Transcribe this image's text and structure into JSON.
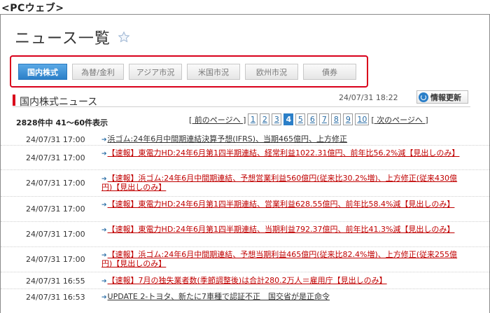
{
  "caption": "<PCウェブ>",
  "title": "ニュース一覧",
  "tabs": [
    {
      "label": "国内株式",
      "active": true
    },
    {
      "label": "為替/金利",
      "active": false
    },
    {
      "label": "アジア市況",
      "active": false
    },
    {
      "label": "米国市況",
      "active": false
    },
    {
      "label": "欧州市況",
      "active": false
    },
    {
      "label": "債券",
      "active": false
    }
  ],
  "section": {
    "title": "国内株式ニュース",
    "updated_at": "24/07/31 18:22",
    "refresh_label": "情報更新"
  },
  "count_text": "2828件中 41～60件表示",
  "pager": {
    "prev": "[ 前のページへ ]",
    "next": "[ 次のページへ ]",
    "pages": [
      "1",
      "2",
      "3",
      "4",
      "5",
      "6",
      "7",
      "8",
      "9",
      "10"
    ],
    "current": "4"
  },
  "news": [
    {
      "time": "24/07/31 17:00",
      "headline": "浜ゴム:24年6月中間期連結決算予想(IFRS)、当期465億円、上方修正",
      "highlight": false
    },
    {
      "time": "24/07/31 17:00",
      "headline": "【速報】東電力HD:24年6月第1四半期連結、経常利益1022.31億円、前年比56.2%減【見出しのみ】",
      "highlight": true
    },
    {
      "time": "24/07/31 17:00",
      "headline": "【速報】浜ゴム:24年6月中間期連結、予想営業利益560億円(従来比30.2%増)、上方修正(従来430億円)【見出しのみ】",
      "highlight": true
    },
    {
      "time": "24/07/31 17:00",
      "headline": "【速報】東電力HD:24年6月第1四半期連結、営業利益628.55億円、前年比58.4%減【見出しのみ】",
      "highlight": true
    },
    {
      "time": "24/07/31 17:00",
      "headline": "【速報】東電力HD:24年6月第1四半期連結、当期利益792.37億円、前年比41.3%減【見出しのみ】",
      "highlight": true
    },
    {
      "time": "24/07/31 17:00",
      "headline": "【速報】浜ゴム:24年6月中間期連結、予想当期利益465億円(従来比82.4%増)、上方修正(従来255億円)【見出しのみ】",
      "highlight": true
    },
    {
      "time": "24/07/31 16:55",
      "headline": "【速報】7月の独失業者数(季節調整後)は合計280.2万人＝雇用庁【見出しのみ】",
      "highlight": true
    },
    {
      "time": "24/07/31 16:53",
      "headline": "UPDATE 2-トヨタ、新たに7車種で認証不正　国交省が是正命令",
      "highlight": false
    }
  ],
  "colors": {
    "accent": "#d9001b",
    "tab_active": "#2b7fc8",
    "link_red": "#c00000"
  },
  "icons": {
    "favorite": "star-icon",
    "refresh": "refresh-icon",
    "arrow": "arrow-icon"
  }
}
